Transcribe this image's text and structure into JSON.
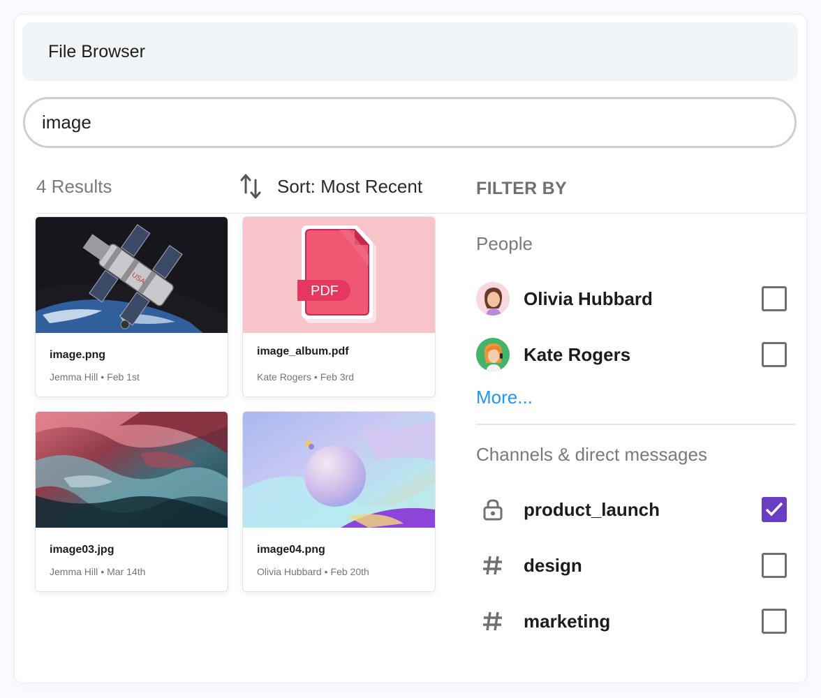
{
  "app": {
    "title": "File Browser"
  },
  "search": {
    "value": "image"
  },
  "results": {
    "count_label": "4 Results"
  },
  "sort": {
    "label": "Sort: Most Recent"
  },
  "files": [
    {
      "name": "image.png",
      "author": "Jemma Hill",
      "date": "Feb 1st",
      "thumb": "hubble-telescope"
    },
    {
      "name": "image_album.pdf",
      "author": "Kate Rogers",
      "date": "Feb 3rd",
      "thumb": "pdf-file"
    },
    {
      "name": "image03.jpg",
      "author": "Jemma Hill",
      "date": "Mar 14th",
      "thumb": "abstract-paint"
    },
    {
      "name": "image04.png",
      "author": "Olivia Hubbard",
      "date": "Feb 20th",
      "thumb": "pastel-sphere"
    }
  ],
  "meta_separator": "•",
  "pdf_badge": "PDF",
  "filter": {
    "heading": "FILTER BY",
    "people_label": "People",
    "people": [
      {
        "name": "Olivia Hubbard",
        "checked": false
      },
      {
        "name": "Kate Rogers",
        "checked": false
      }
    ],
    "more_label": "More...",
    "channels_label": "Channels & direct messages",
    "channels": [
      {
        "name": "product_launch",
        "icon": "lock-icon",
        "checked": true
      },
      {
        "name": "design",
        "icon": "hash-icon",
        "checked": false
      },
      {
        "name": "marketing",
        "icon": "hash-icon",
        "checked": false
      }
    ]
  },
  "colors": {
    "accent": "#6a3ec2",
    "link": "#2196f3",
    "pdf_red": "#e5375f",
    "pdf_bg": "#f6c4c9"
  }
}
